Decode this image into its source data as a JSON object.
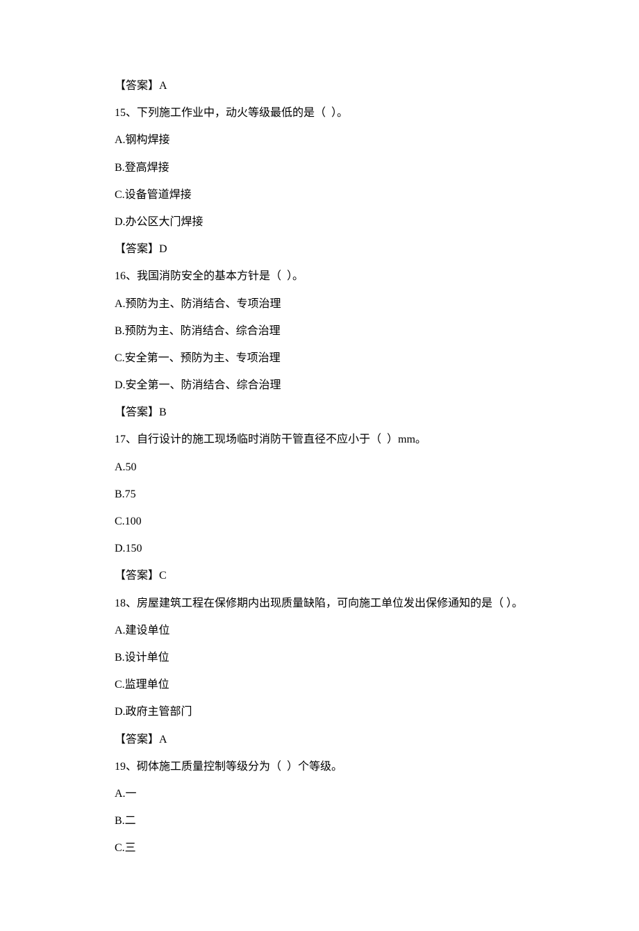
{
  "lines": [
    "【答案】A",
    "15、下列施工作业中，动火等级最低的是（  ）。",
    "A.钢构焊接",
    "B.登高焊接",
    "C.设备管道焊接",
    "D.办公区大门焊接",
    "【答案】D",
    "16、我国消防安全的基本方针是（  ）。",
    "A.预防为主、防消结合、专项治理",
    "B.预防为主、防消结合、综合治理",
    "C.安全第一、预防为主、专项治理",
    "D.安全第一、防消结合、综合治理",
    "【答案】B",
    "17、自行设计的施工现场临时消防干管直径不应小于（  ）mm。",
    "A.50",
    "B.75",
    "C.100",
    "D.150",
    "【答案】C",
    "18、房屋建筑工程在保修期内出现质量缺陷，可向施工单位发出保修通知的是（ ）。",
    "A.建设单位",
    "B.设计单位",
    "C.监理单位",
    "D.政府主管部门",
    "【答案】A",
    "19、砌体施工质量控制等级分为（  ）个等级。",
    "A.一",
    "B.二",
    "C.三"
  ]
}
